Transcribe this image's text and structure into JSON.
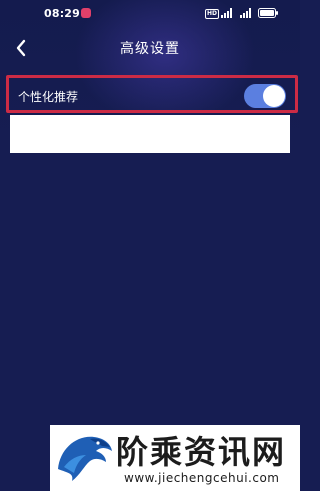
{
  "status_bar": {
    "time": "08:29",
    "hd_label": "HD",
    "icons": [
      "notification-icon",
      "signal-icon",
      "signal-icon",
      "battery-icon"
    ]
  },
  "header": {
    "title": "高级设置",
    "back_icon": "chevron-left-icon"
  },
  "settings": {
    "personalized_recommendation": {
      "label": "个性化推荐",
      "enabled": true,
      "highlighted": true
    }
  },
  "watermark": {
    "title": "阶乘资讯网",
    "url": "www.jiechengcehui.com",
    "logo": "eagle-logo"
  },
  "colors": {
    "background": "#161d52",
    "toggle_on": "#5b7fe0",
    "highlight_border": "#cc2b45"
  }
}
